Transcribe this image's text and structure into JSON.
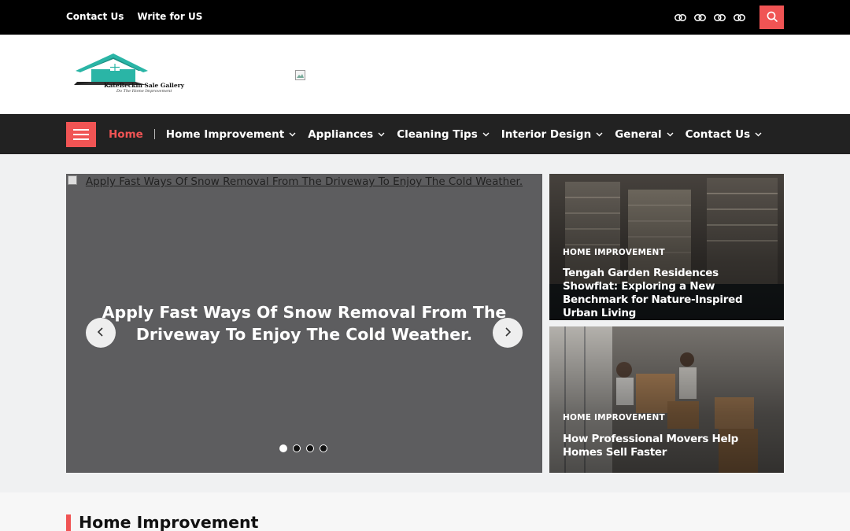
{
  "topbar": {
    "links": [
      "Contact Us",
      "Write for US"
    ],
    "social_icons": [
      "link-icon",
      "link-icon",
      "link-icon",
      "link-icon"
    ],
    "search_icon": "search-icon",
    "accent": "#f05454"
  },
  "header": {
    "logo": {
      "brand": "KateBeckin Sale Gallery",
      "tagline": "Do The Home Improvement"
    }
  },
  "nav": {
    "items": [
      {
        "label": "Home",
        "active": true
      },
      {
        "label": "Home Improvement"
      },
      {
        "label": "Appliances"
      },
      {
        "label": "Cleaning Tips"
      },
      {
        "label": "Interior Design"
      },
      {
        "label": "General"
      },
      {
        "label": "Contact Us"
      }
    ]
  },
  "slider": {
    "image_alt": "Apply Fast Ways Of Snow Removal From The Driveway To Enjoy The Cold Weather.",
    "caption": "Apply Fast Ways Of Snow Removal From The Driveway To Enjoy The Cold Weather.",
    "slide_count": 4,
    "active_slide": 1
  },
  "featured": [
    {
      "category": "HOME IMPROVEMENT",
      "title": "Tengah Garden Residences Showflat: Exploring a New Benchmark for Nature-Inspired Urban Living"
    },
    {
      "category": "HOME IMPROVEMENT",
      "title": "How Professional Movers Help Homes Sell Faster"
    }
  ],
  "section": {
    "title": "Home Improvement"
  }
}
